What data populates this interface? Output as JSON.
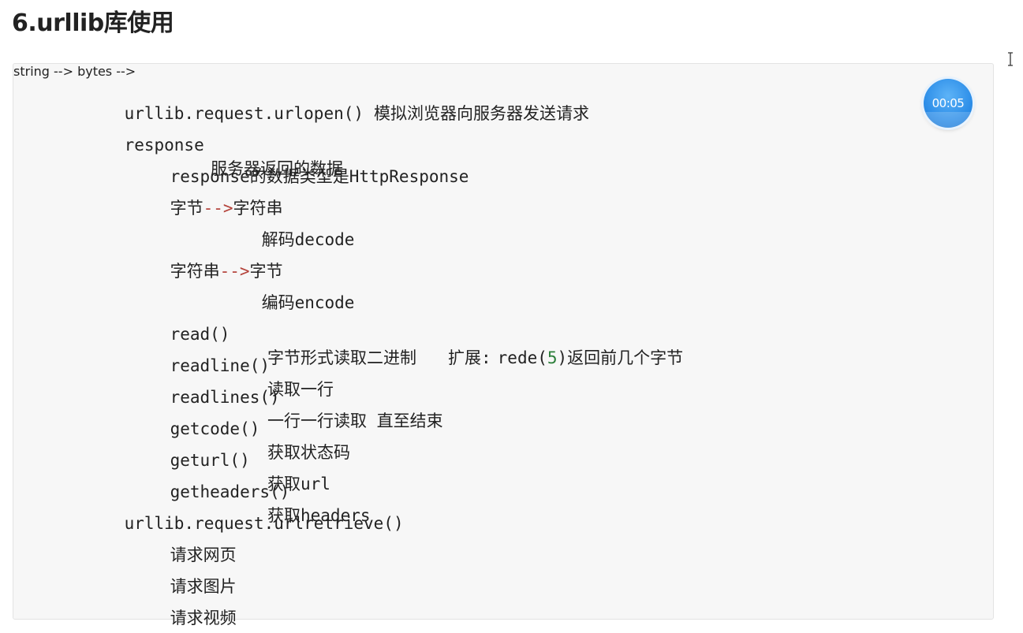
{
  "heading": "6.urllib库使用",
  "timer": {
    "label": "00:05"
  },
  "lines": {
    "urlopen": {
      "code": "urllib.request.urlopen()",
      "desc": "模拟浏览器向服务器发送请求"
    },
    "response": {
      "code": "response",
      "desc": "服务器返回的数据"
    },
    "response_type": "response的数据类型是HttpResponse",
    "bytes_to_str": {
      "left": "字节",
      "arrow": "-->",
      "right": "字符串"
    },
    "decode": "解码decode",
    "str_to_bytes": {
      "left": "字符串",
      "arrow": "-->",
      "right": "字节"
    },
    "encode": "编码encode",
    "read": {
      "code": "read()",
      "desc": "字节形式读取二进制",
      "ext_prefix": "扩展:",
      "ext_code": "rede(",
      "ext_num": "5",
      "ext_suffix": ")返回前几个字节"
    },
    "readline": {
      "code": "readline()",
      "desc": "读取一行"
    },
    "readlines": {
      "code": "readlines()",
      "desc": "一行一行读取 直至结束"
    },
    "getcode": {
      "code": "getcode()",
      "desc": "获取状态码"
    },
    "geturl": {
      "code": "geturl()",
      "desc": "获取url"
    },
    "getheaders": {
      "code": "getheaders()",
      "desc": "获取headers"
    },
    "urlretrieve": "urllib.request.urlretrieve()",
    "req_page": "请求网页",
    "req_image": "请求图片",
    "req_video": "请求视频"
  },
  "colors": {
    "arrow": "#b4423a",
    "number": "#2c7f3a",
    "timer": "#2d8ee8"
  },
  "icons": {
    "cursor": "text-cursor-icon"
  }
}
